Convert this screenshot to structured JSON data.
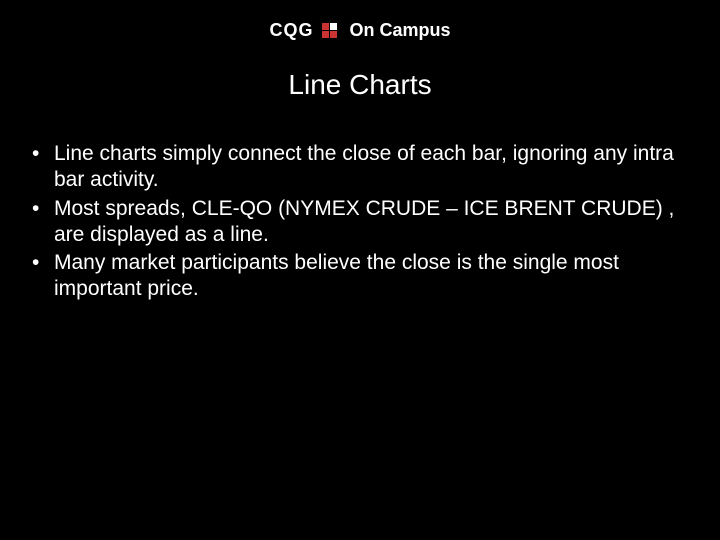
{
  "header": {
    "logo_text": "CQG",
    "program_text": "On Campus"
  },
  "slide": {
    "title": "Line Charts",
    "bullets": [
      "Line charts simply connect the close of each bar, ignoring any intra bar activity.",
      "Most spreads, CLE-QO (NYMEX CRUDE – ICE BRENT CRUDE) , are displayed as a line.",
      "Many market participants believe the close is the single most important price."
    ]
  }
}
